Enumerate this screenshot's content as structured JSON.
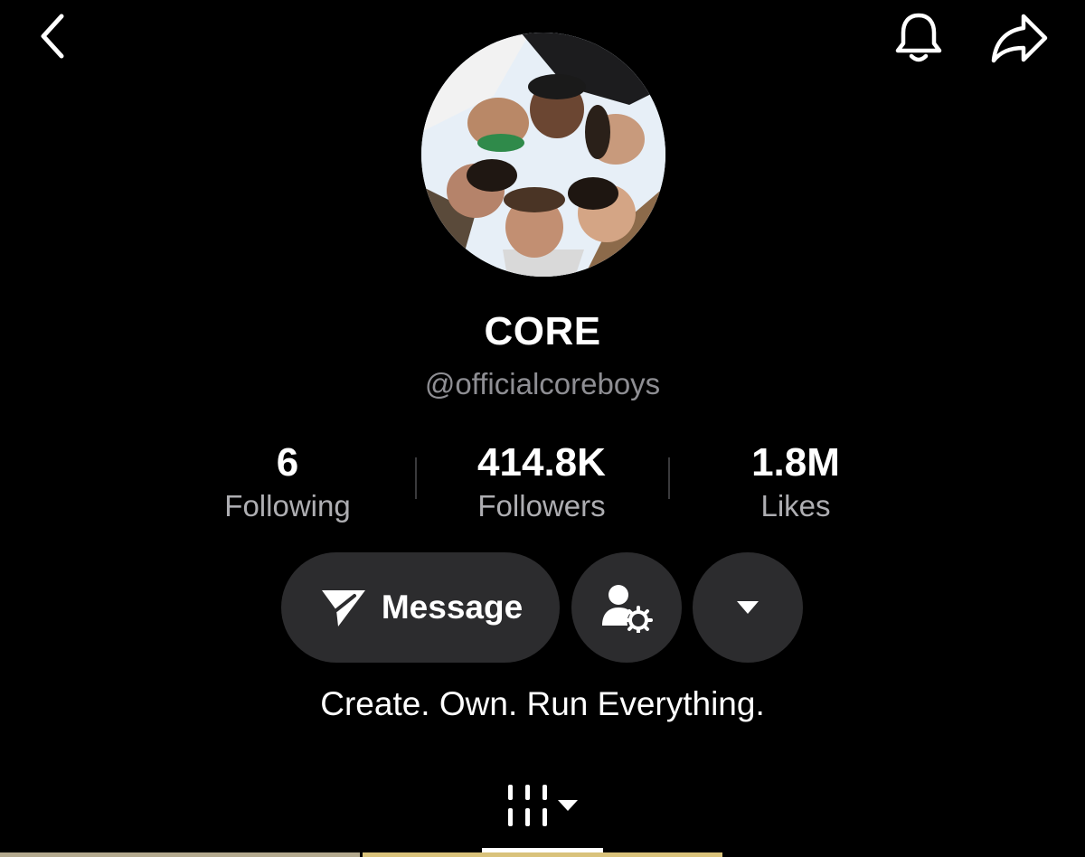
{
  "profile": {
    "display_name": "CORE",
    "handle": "@officialcoreboys",
    "bio": "Create. Own. Run Everything."
  },
  "stats": [
    {
      "value": "6",
      "label": "Following"
    },
    {
      "value": "414.8K",
      "label": "Followers"
    },
    {
      "value": "1.8M",
      "label": "Likes"
    }
  ],
  "actions": {
    "message_label": "Message"
  },
  "icons": {
    "back": "chevron-left-icon",
    "notifications": "bell-icon",
    "share": "share-arrow-icon",
    "message": "paper-plane-icon",
    "friends": "person-gear-icon",
    "more": "caret-down-icon",
    "videos_tab": "grid-bars-icon"
  },
  "colors": {
    "background": "#000000",
    "button_bg": "#2c2c2e",
    "secondary_text": "#8e8e93",
    "accent_text": "#ffffff"
  }
}
